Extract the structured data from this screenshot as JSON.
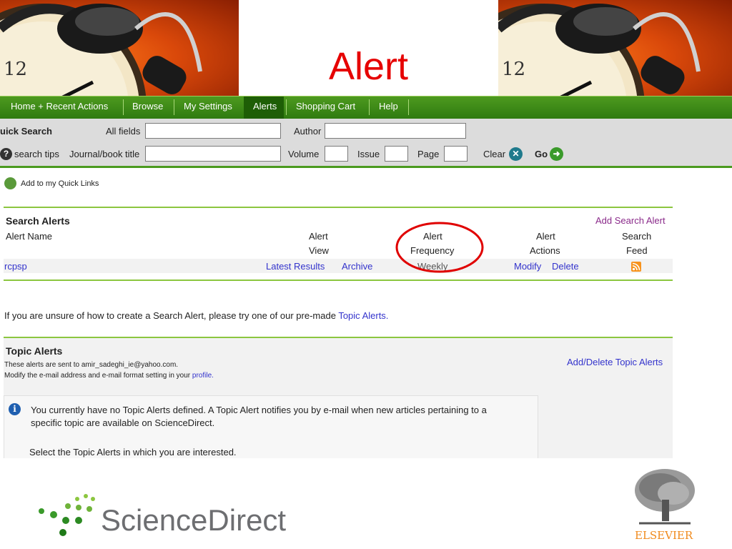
{
  "header": {
    "title": "Alert"
  },
  "nav": {
    "items": [
      "Home + Recent Actions",
      "Browse",
      "My Settings",
      "Alerts",
      "Shopping Cart",
      "Help"
    ],
    "active": "Alerts"
  },
  "quick_search": {
    "title": "uick Search",
    "all_fields_label": "All fields",
    "author_label": "Author",
    "search_tips": "search tips",
    "journal_label": "Journal/book title",
    "volume_label": "Volume",
    "issue_label": "Issue",
    "page_label": "Page",
    "clear_label": "Clear",
    "go_label": "Go"
  },
  "quick_links": "Add to my Quick Links",
  "search_alerts": {
    "title": "Search Alerts",
    "add_link": "Add Search Alert",
    "col_name": "Alert Name",
    "col_view_1": "Alert",
    "col_view_2": "View",
    "col_freq_1": "Alert",
    "col_freq_2": "Frequency",
    "col_actions_1": "Alert",
    "col_actions_2": "Actions",
    "col_feed_1": "Search",
    "col_feed_2": "Feed",
    "rows": [
      {
        "name": "rcpsp",
        "latest": "Latest Results",
        "archive": "Archive",
        "frequency": "Weekly",
        "modify": "Modify",
        "delete": "Delete"
      }
    ]
  },
  "unsure": {
    "text": "If you are unsure of how to create a Search Alert, please try one of our pre-made",
    "link": "Topic Alerts."
  },
  "topic_alerts": {
    "title": "Topic Alerts",
    "line1": "These alerts are sent to amir_sadeghi_ie@yahoo.com.",
    "line2": "Modify the e-mail address and e-mail format setting in your",
    "profile_link": "profile.",
    "add_delete_link": "Add/Delete Topic Alerts",
    "info_1": "You currently have no Topic Alerts defined. A Topic Alert notifies you by e-mail when new articles pertaining to a",
    "info_2": "specific topic are available on ScienceDirect.",
    "info_3": "Select the Topic Alerts in which you are interested."
  },
  "footer": {
    "sciencedirect": "ScienceDirect",
    "elsevier": "ELSEVIER"
  },
  "colors": {
    "nav_green": "#3b8a15",
    "title_red": "#e60000",
    "link_blue": "#3333cc",
    "highlight_red": "#e00000"
  }
}
